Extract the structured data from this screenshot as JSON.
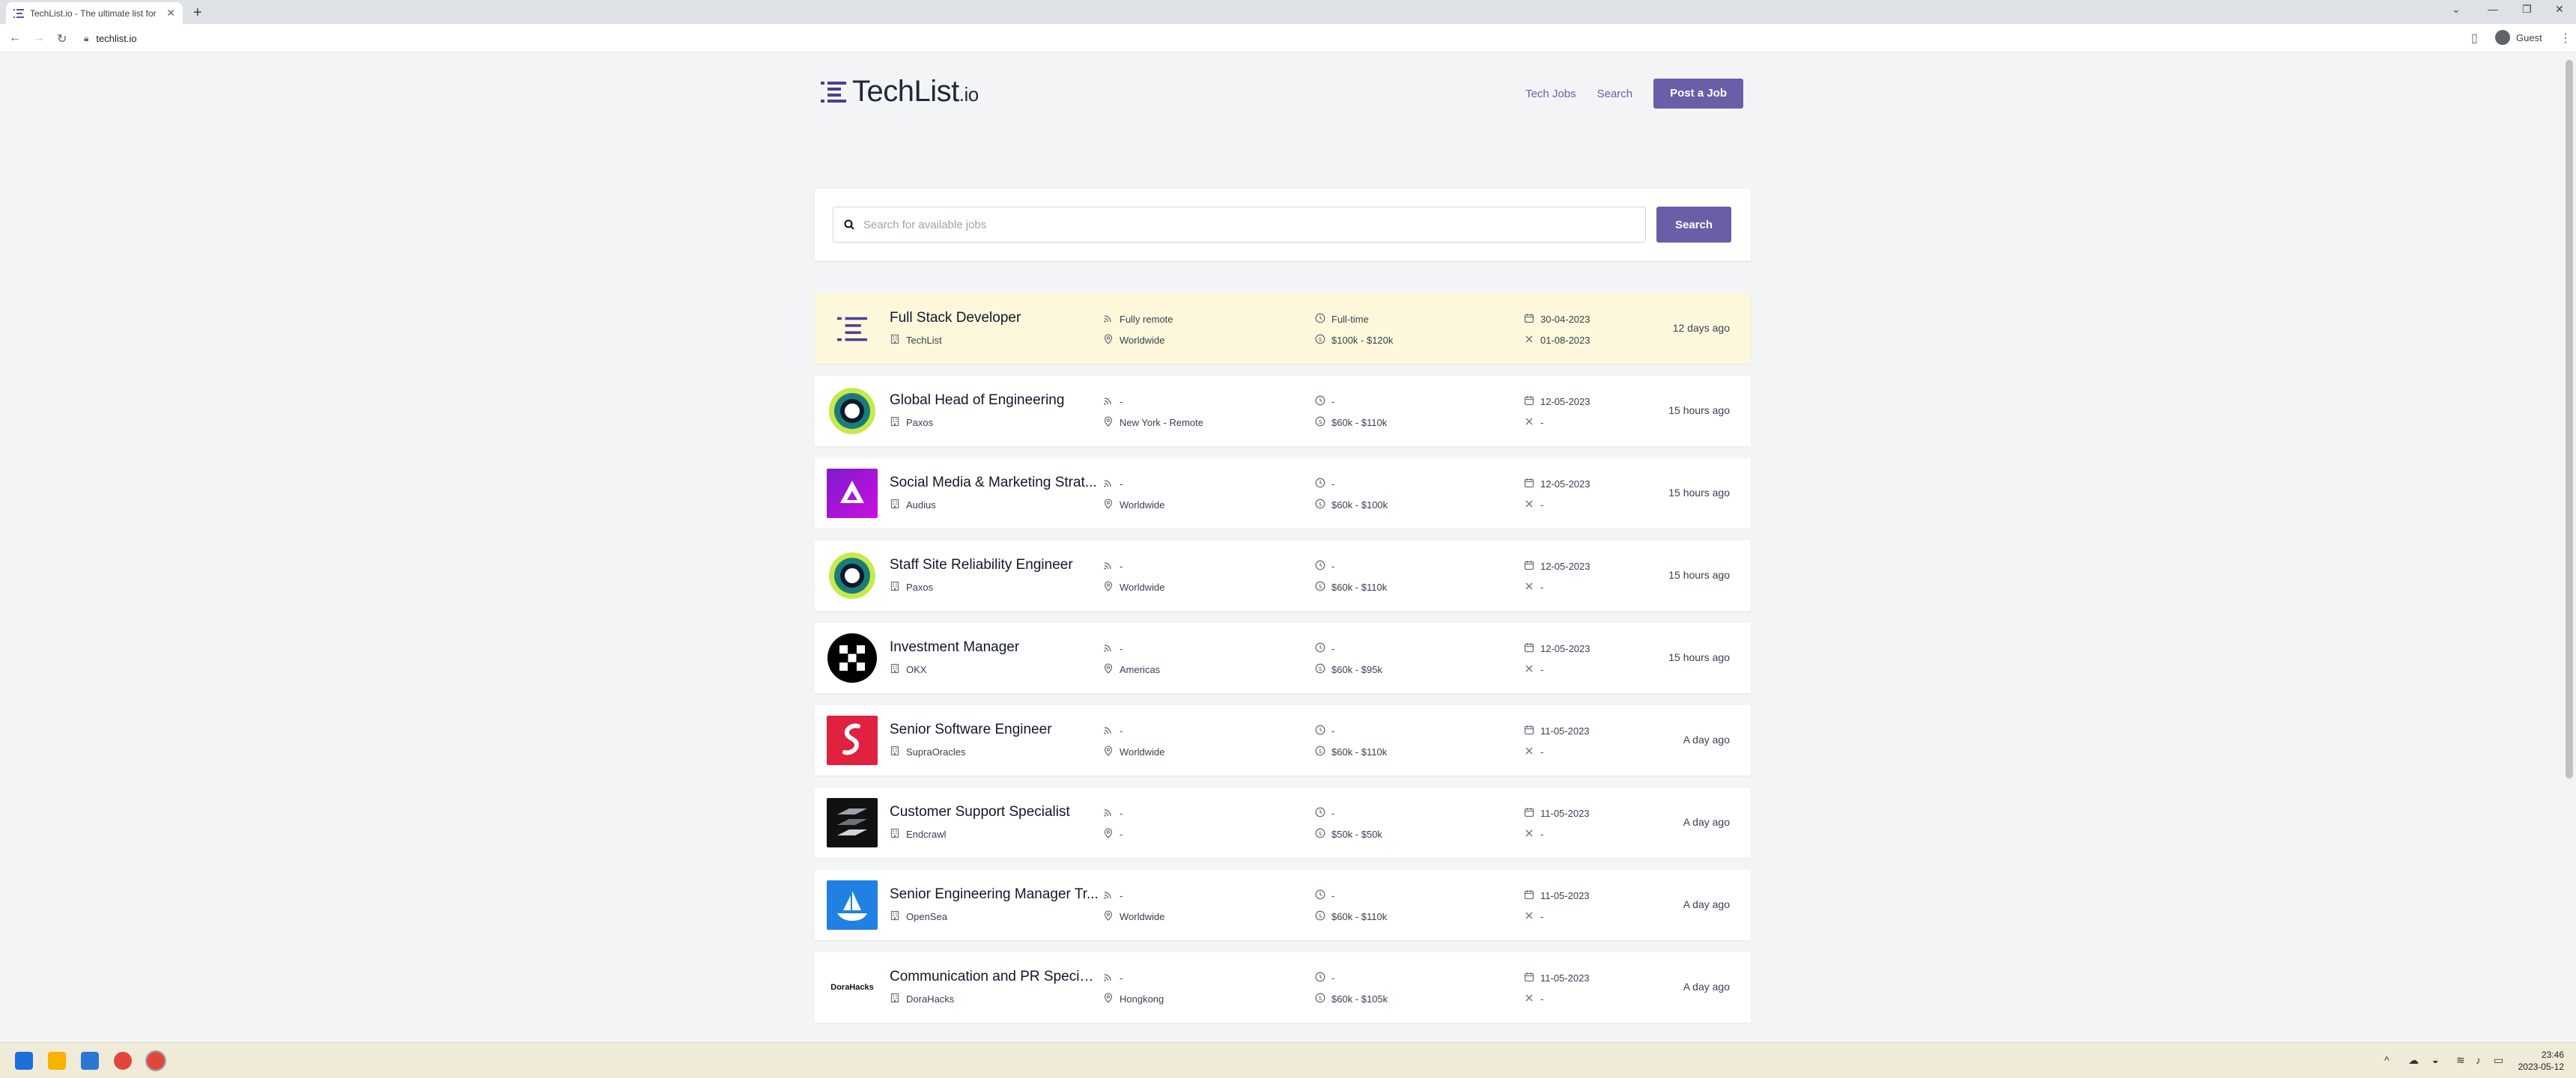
{
  "browser": {
    "tab_title": "TechList.io - The ultimate list for",
    "url": "techlist.io",
    "profile": "Guest"
  },
  "site": {
    "logo": "TechList",
    "logo_suffix": ".io",
    "nav": {
      "tech_jobs": "Tech Jobs",
      "search": "Search",
      "post_job": "Post a Job"
    }
  },
  "search": {
    "placeholder": "Search for available jobs",
    "button": "Search"
  },
  "colors": {
    "accent": "#6b5ea8",
    "featured_bg": "#fdf8dc"
  },
  "jobs": [
    {
      "title": "Full Stack Developer",
      "company": "TechList",
      "remote": "Fully remote",
      "location": "Worldwide",
      "type": "Full-time",
      "salary": "$100k - $120k",
      "posted": "30-04-2023",
      "expires": "01-08-2023",
      "ago": "12 days ago",
      "logo": "techlist-logo"
    },
    {
      "title": "Global Head of Engineering",
      "company": "Paxos",
      "remote": "-",
      "location": "New York - Remote",
      "type": "-",
      "salary": "$60k - $110k",
      "posted": "12-05-2023",
      "expires": "-",
      "ago": "15 hours ago",
      "logo": "paxos-logo"
    },
    {
      "title": "Social Media & Marketing Strat...",
      "company": "Audius",
      "remote": "-",
      "location": "Worldwide",
      "type": "-",
      "salary": "$60k - $100k",
      "posted": "12-05-2023",
      "expires": "-",
      "ago": "15 hours ago",
      "logo": "audius-logo"
    },
    {
      "title": "Staff Site Reliability Engineer",
      "company": "Paxos",
      "remote": "-",
      "location": "Worldwide",
      "type": "-",
      "salary": "$60k - $110k",
      "posted": "12-05-2023",
      "expires": "-",
      "ago": "15 hours ago",
      "logo": "paxos-logo"
    },
    {
      "title": "Investment Manager",
      "company": "OKX",
      "remote": "-",
      "location": "Americas",
      "type": "-",
      "salary": "$60k - $95k",
      "posted": "12-05-2023",
      "expires": "-",
      "ago": "15 hours ago",
      "logo": "okx-logo"
    },
    {
      "title": "Senior Software Engineer",
      "company": "SupraOracles",
      "remote": "-",
      "location": "Worldwide",
      "type": "-",
      "salary": "$60k - $110k",
      "posted": "11-05-2023",
      "expires": "-",
      "ago": "A day ago",
      "logo": "supraoracles-logo"
    },
    {
      "title": "Customer Support Specialist",
      "company": "Endcrawl",
      "remote": "-",
      "location": "-",
      "type": "-",
      "salary": "$50k - $50k",
      "posted": "11-05-2023",
      "expires": "-",
      "ago": "A day ago",
      "logo": "endcrawl-logo"
    },
    {
      "title": "Senior Engineering Manager Tr...",
      "company": "OpenSea",
      "remote": "-",
      "location": "Worldwide",
      "type": "-",
      "salary": "$60k - $110k",
      "posted": "11-05-2023",
      "expires": "-",
      "ago": "A day ago",
      "logo": "opensea-logo"
    },
    {
      "title": "Communication and PR Special...",
      "company": "DoraHacks",
      "remote": "-",
      "location": "Hongkong",
      "type": "-",
      "salary": "$60k - $105k",
      "posted": "11-05-2023",
      "expires": "-",
      "ago": "A day ago",
      "logo": "dorahacks-logo",
      "logo_text": "DoraHacks"
    }
  ],
  "taskbar": {
    "time": "23:46",
    "date": "2023-05-12"
  }
}
